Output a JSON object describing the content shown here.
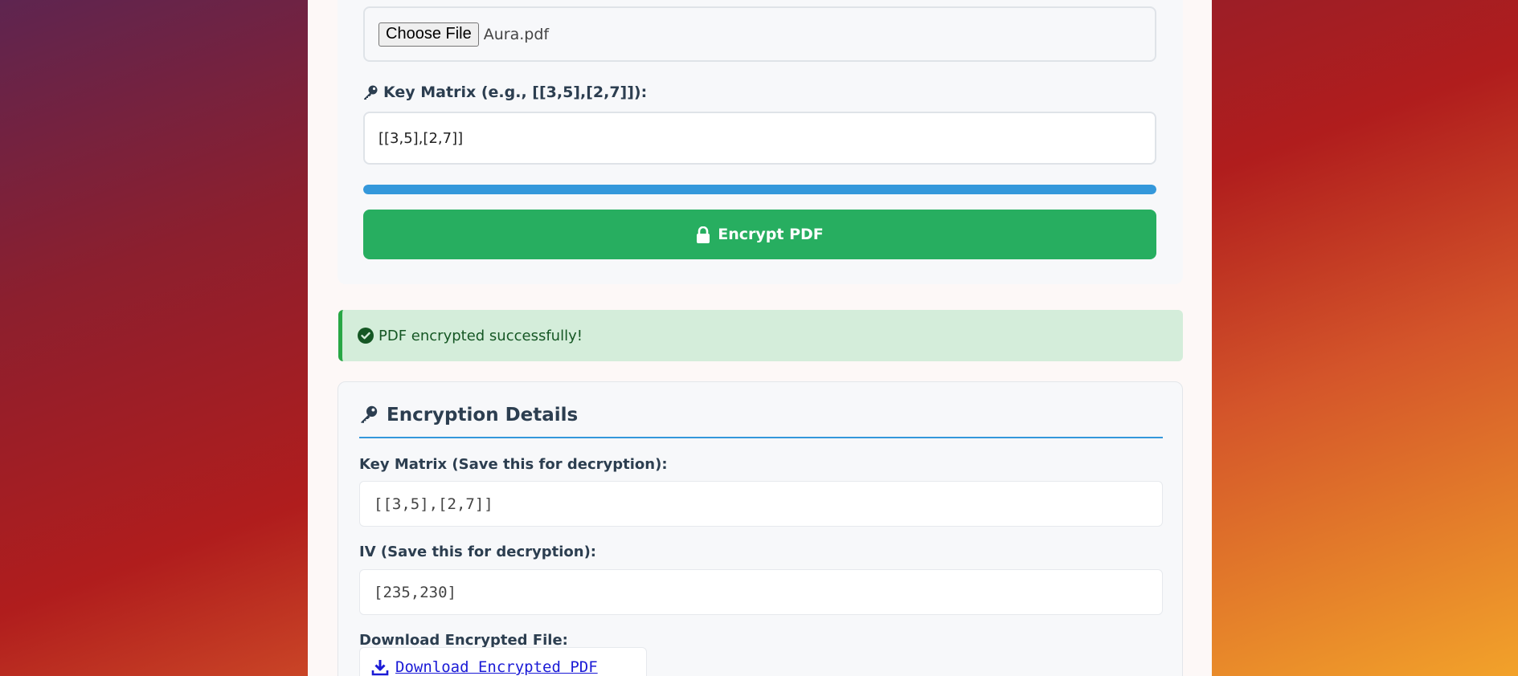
{
  "upload": {
    "button_label": "Choose File",
    "file_name": "Aura.pdf"
  },
  "key_matrix": {
    "label": "Key Matrix (e.g., [[3,5],[2,7]]):",
    "value": "[[3,5],[2,7]]"
  },
  "progress": {
    "fraction": 1.0
  },
  "encrypt_button": {
    "label": "Encrypt PDF"
  },
  "alert": {
    "message": "PDF encrypted successfully!"
  },
  "details": {
    "title": "Encryption Details",
    "key_label": "Key Matrix (Save this for decryption):",
    "key_value": "[[3,5],[2,7]]",
    "iv_label": "IV (Save this for decryption):",
    "iv_value": "[235,230]",
    "download_label": "Download Encrypted File:",
    "download_link": "Download Encrypted PDF"
  },
  "colors": {
    "primary_blue": "#3498db",
    "success_green": "#27ae60",
    "alert_bg": "#d4edda",
    "heading_text": "#2c3e50"
  },
  "icons": {
    "key": "key-icon",
    "lock": "lock-icon",
    "check": "check-circle-icon",
    "download": "download-icon"
  }
}
